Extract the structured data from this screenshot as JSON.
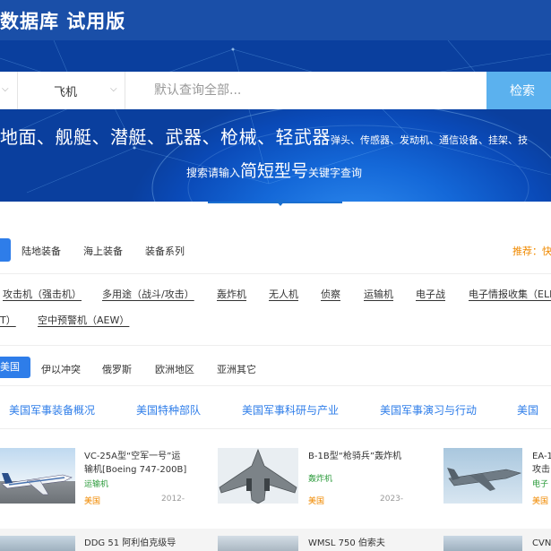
{
  "header": {
    "title": "数据库 试用版"
  },
  "search": {
    "select1": "",
    "select2": "飞机",
    "placeholder": "默认查询全部...",
    "button": "检索"
  },
  "hero": {
    "categories_big": "地面、舰艇、潜艇、武器、枪械、轻武器",
    "categories_small": "弹头、传感器、发动机、通信设备、挂架、技",
    "hint_prefix": "搜索请输入",
    "hint_big": "简短型号",
    "hint_suffix": "关键字查询"
  },
  "tabs": {
    "items": [
      "陆地装备",
      "海上装备",
      "装备系列"
    ],
    "recommend": "推荐：快"
  },
  "subcats": {
    "row1": [
      "攻击机（强击机）",
      "多用途（战斗/攻击）",
      "轰炸机",
      "无人机",
      "侦察",
      "运输机",
      "电子战",
      "电子情报收集（ELI"
    ],
    "row2_prefix": "T）",
    "row2": [
      "空中预警机（AEW）"
    ]
  },
  "regions": {
    "active": "美国",
    "items": [
      "伊以冲突",
      "俄罗斯",
      "欧洲地区",
      "亚洲其它"
    ]
  },
  "topics": [
    "美国军事装备概况",
    "美国特种部队",
    "美国军事科研与产业",
    "美国军事演习与行动",
    "美国"
  ],
  "cards": [
    {
      "title1": "VC-25A型“空军一号”运",
      "title2": "输机[Boeing 747-200B]",
      "type": "运输机",
      "country": "美国",
      "year": "2012-"
    },
    {
      "title1": "B-1B型“枪骑兵”轰炸机",
      "title2": "",
      "type": "轰炸机",
      "country": "美国",
      "year": "2023-"
    },
    {
      "title1": "EA-1",
      "title2": "攻击",
      "type": "电子",
      "country": "美国",
      "year": ""
    }
  ],
  "cards_row2": [
    "DDG 51 阿利伯克级导",
    "WMSL 750 伯索夫",
    "CVN"
  ]
}
